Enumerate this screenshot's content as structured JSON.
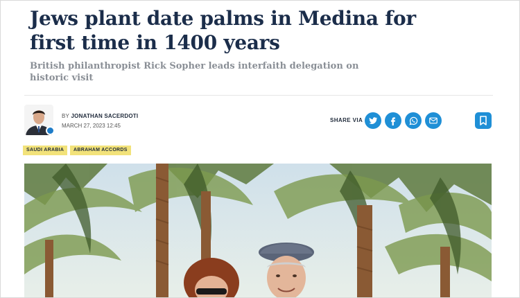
{
  "article": {
    "headline": "Jews plant date palms in Medina for first time in 1400 years",
    "subheadline": "British philanthropist Rick Sopher leads interfaith delegation on historic visit",
    "byline_prefix": "BY",
    "author": "JONATHAN SACERDOTI",
    "date": "MARCH 27, 2023 12:45"
  },
  "share": {
    "label": "SHARE VIA",
    "buttons": [
      {
        "icon": "twitter-icon"
      },
      {
        "icon": "facebook-icon"
      },
      {
        "icon": "whatsapp-icon"
      },
      {
        "icon": "email-icon"
      }
    ],
    "bookmark_icon": "bookmark-icon",
    "accent_color": "#1f8fd6"
  },
  "tags": [
    "SAUDI ARABIA",
    "ABRAHAM ACCORDS"
  ],
  "colors": {
    "headline": "#1b2d4a",
    "subhead": "#8a8f96",
    "tag_background": "#f2e27a"
  }
}
